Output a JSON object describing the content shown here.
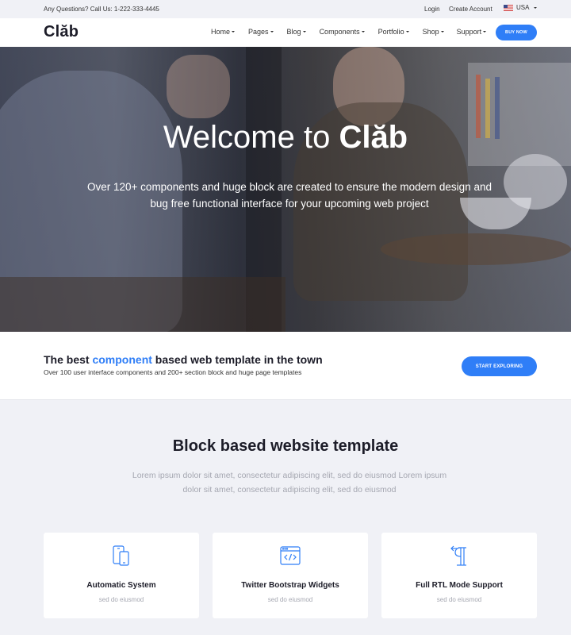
{
  "topbar": {
    "contact": "Any Questions? Call Us: 1-222-333-4445",
    "login": "Login",
    "create_account": "Create Account",
    "language": "USA"
  },
  "nav": {
    "logo": "Clăb",
    "items": [
      "Home",
      "Pages",
      "Blog",
      "Components",
      "Portfolio",
      "Shop",
      "Support"
    ],
    "buy_label": "BUY NOW"
  },
  "hero": {
    "title_prefix": "Welcome to ",
    "title_brand": "Clăb",
    "subtitle": "Over 120+ components and huge block are created to ensure the modern design and bug free functional interface for your upcoming web project"
  },
  "strip": {
    "title_before": "The best ",
    "title_accent": "component",
    "title_after": " based web template in the town",
    "subtitle": "Over 100 user interface components and 200+ section block and huge page templates",
    "button": "START EXPLORING"
  },
  "section": {
    "title": "Block based website template",
    "subtitle": "Lorem ipsum dolor sit amet, consectetur adipiscing elit, sed do eiusmod Lorem ipsum dolor sit amet, consectetur adipiscing elit, sed do eiusmod"
  },
  "features": [
    {
      "icon": "devices-icon",
      "title": "Automatic System",
      "subtitle": "sed do eiusmod"
    },
    {
      "icon": "code-window-icon",
      "title": "Twitter Bootstrap Widgets",
      "subtitle": "sed do eiusmod"
    },
    {
      "icon": "rtl-paragraph-icon",
      "title": "Full RTL Mode Support",
      "subtitle": "sed do eiusmod"
    }
  ],
  "colors": {
    "accent": "#2f7ef7",
    "page_bg": "#f0f1f6",
    "text_dark": "#1c1c28",
    "text_muted": "#a5a7b1"
  }
}
